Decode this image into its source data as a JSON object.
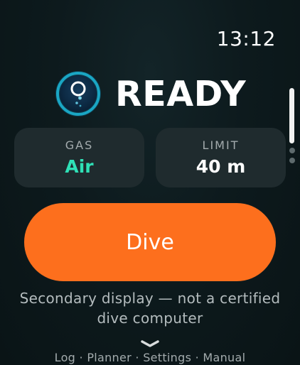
{
  "status_bar": {
    "time": "13:12"
  },
  "header": {
    "icon": "bubble-icon",
    "status": "READY",
    "icon_color": "#1aa6c4"
  },
  "stats": [
    {
      "label": "GAS",
      "value": "Air",
      "value_color": "#2fe0b6"
    },
    {
      "label": "LIMIT",
      "value": "40 m",
      "value_color": "#ffffff"
    }
  ],
  "action": {
    "dive_label": "Dive",
    "color": "#fd6f1d"
  },
  "disclaimer": {
    "line1": "Secondary display — not a certified",
    "line2": "dive computer"
  },
  "footer": {
    "scroll_hint_icon": "chevron-down-icon",
    "links": [
      "Log",
      "Planner",
      "Settings",
      "Manual"
    ],
    "separator": "·"
  }
}
